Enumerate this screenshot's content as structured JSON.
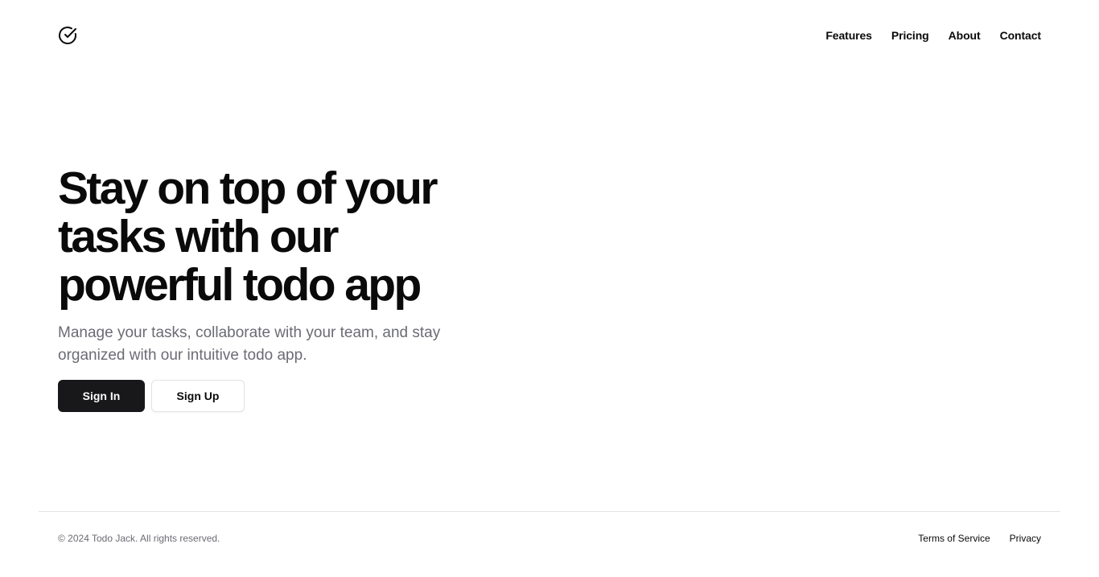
{
  "header": {
    "logo_icon": "circle-check-icon",
    "nav": {
      "features": "Features",
      "pricing": "Pricing",
      "about": "About",
      "contact": "Contact"
    }
  },
  "hero": {
    "title": "Stay on top of your tasks with our powerful todo app",
    "subtitle": "Manage your tasks, collaborate with your team, and stay organized with our intuitive todo app.",
    "sign_in_label": "Sign In",
    "sign_up_label": "Sign Up"
  },
  "footer": {
    "copyright": "© 2024 Todo Jack. All rights reserved.",
    "terms": "Terms of Service",
    "privacy": "Privacy"
  },
  "colors": {
    "primary": "#18181b",
    "muted_text": "#6b6b74",
    "border": "#e4e4e7",
    "background": "#ffffff"
  }
}
